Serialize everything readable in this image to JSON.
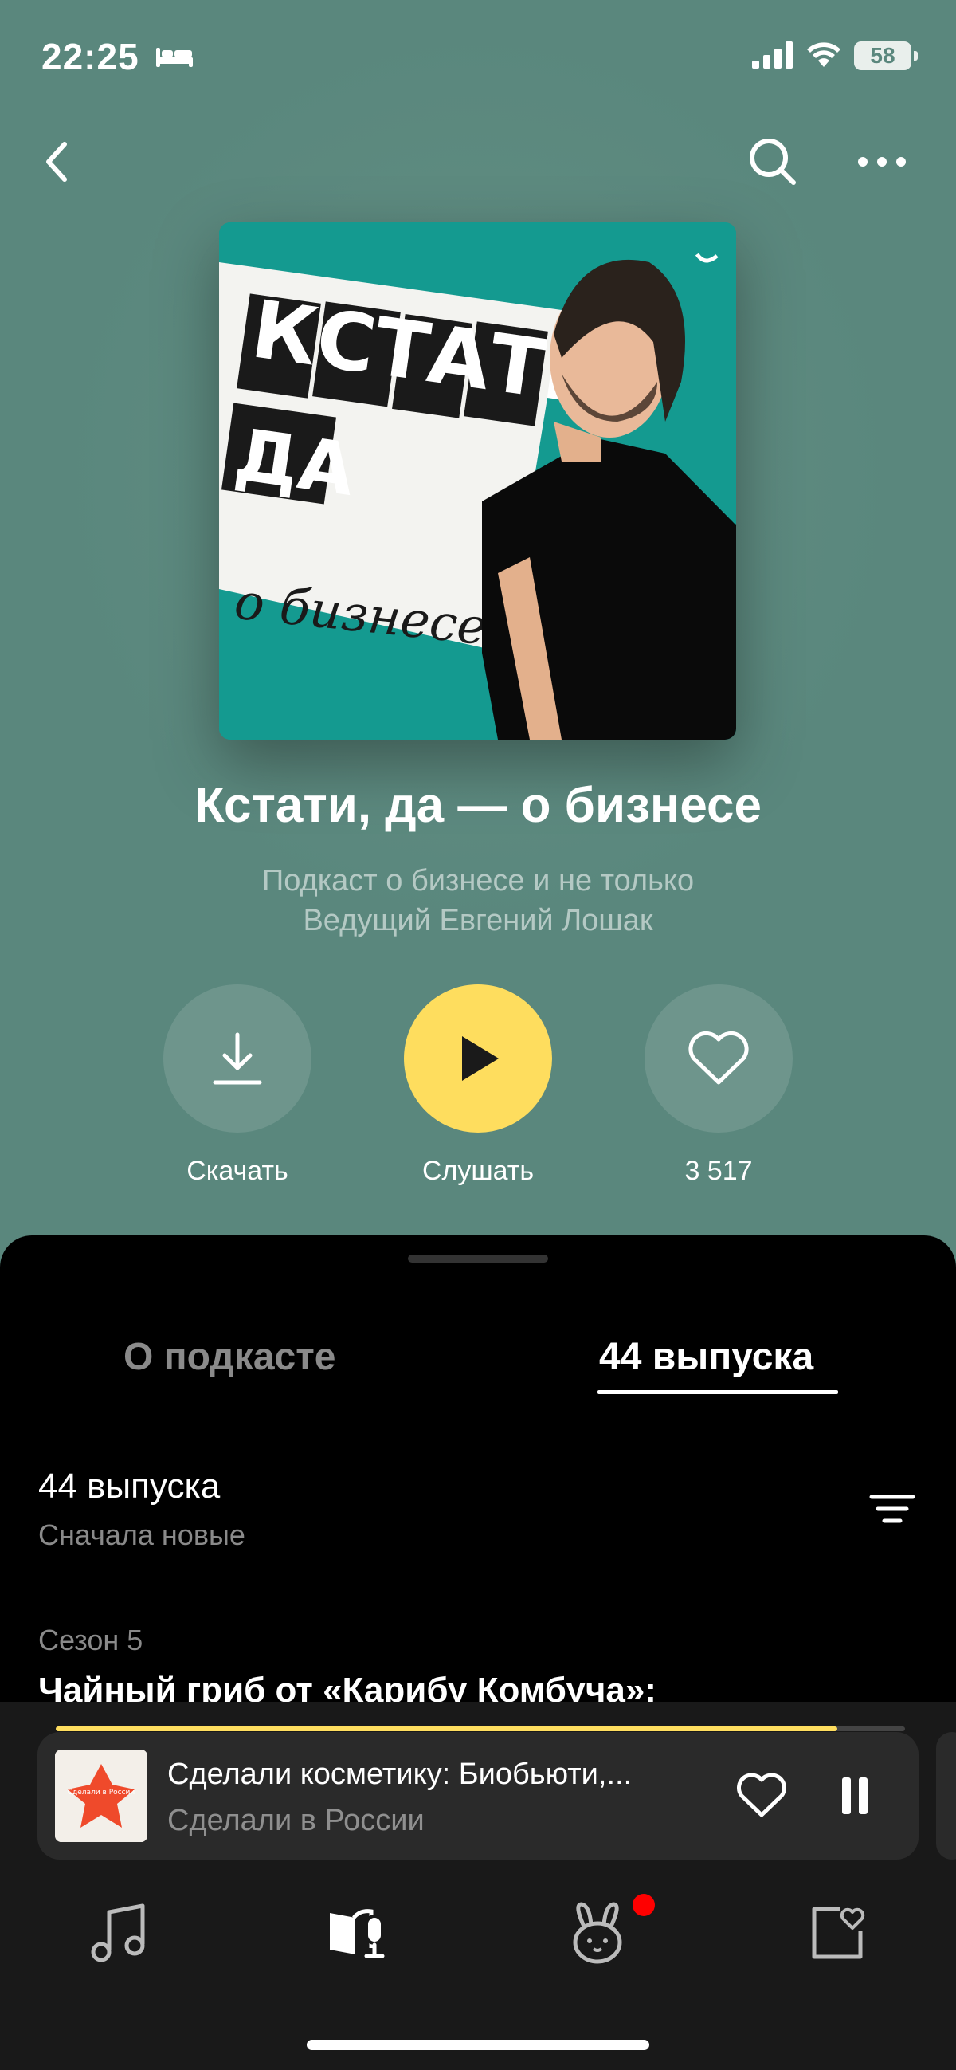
{
  "status_bar": {
    "time": "22:25",
    "battery": "58"
  },
  "podcast": {
    "title": "Кстати, да — о бизнесе",
    "description_line1": "Подкаст о бизнесе и не только",
    "description_line2": "Ведущий Евгений Лошак"
  },
  "cover": {
    "line1": "КСТАТИ,",
    "line2": "ДА",
    "subtitle": "о бизнесе"
  },
  "actions": {
    "download_label": "Скачать",
    "listen_label": "Слушать",
    "likes_count": "3 517"
  },
  "tabs": [
    {
      "label": "О подкасте",
      "active": false
    },
    {
      "label": "44 выпуска",
      "active": true
    }
  ],
  "episodes": {
    "count_label": "44 выпуска",
    "sort_label": "Сначала новые",
    "season_label": "Сезон 5",
    "first_episode_title": "Чайный гриб от «Карибу Комбуча»:"
  },
  "mini_player": {
    "title": "Сделали косметику: Биобьюти,...",
    "subtitle": "Сделали в России",
    "progress": 0.92,
    "art_text": "Сделали в России"
  },
  "bottom_nav": [
    {
      "icon": "music-note-icon"
    },
    {
      "icon": "podcast-book-icon"
    },
    {
      "icon": "kids-bunny-icon",
      "has_notification": true
    },
    {
      "icon": "collection-heart-icon"
    }
  ],
  "colors": {
    "header_bg": "#5e8b80",
    "accent": "#fedd5e",
    "cover_teal": "#149a90",
    "notification": "#ff0000"
  }
}
